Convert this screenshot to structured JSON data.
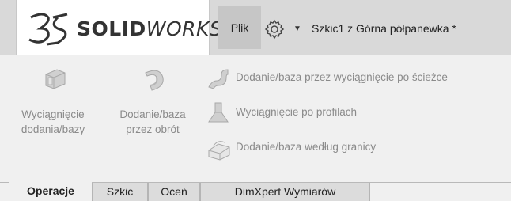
{
  "header": {
    "brand_bold": "SOLID",
    "brand_italic": "WORKS",
    "menu_file": "Plik",
    "doc_title": "Szkic1 z Górna półpanewka *"
  },
  "ribbon": {
    "extrude_boss": [
      "Wyciągnięcie",
      "dodania/bazy"
    ],
    "revolve_boss": [
      "Dodanie/baza",
      "przez obrót"
    ],
    "swept_boss": "Dodanie/baza przez wyciągnięcie po ścieżce",
    "lofted_boss": "Wyciągnięcie po profilach",
    "boundary_boss": "Dodanie/baza według granicy"
  },
  "tabs": [
    {
      "label": "Operacje",
      "active": true
    },
    {
      "label": "Szkic",
      "active": false
    },
    {
      "label": "Oceń",
      "active": false
    },
    {
      "label": "DimXpert Wymiarów",
      "active": false
    }
  ],
  "colors": {
    "icon_disabled": "#b8b8b8",
    "text_disabled": "#8a8a8a",
    "topbar": "#d9d9d9"
  }
}
